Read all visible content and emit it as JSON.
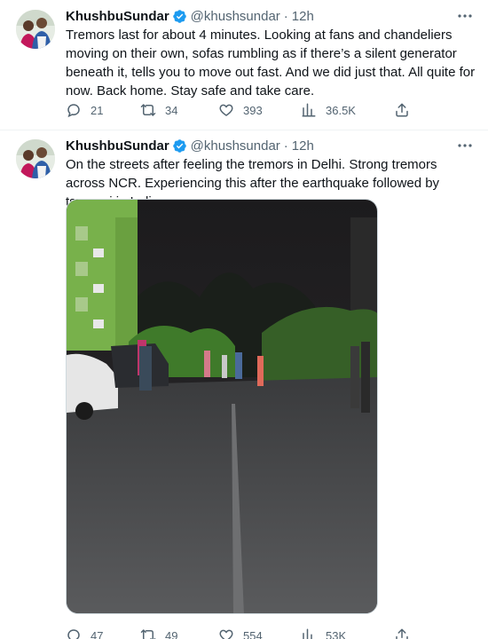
{
  "tweets": [
    {
      "author": {
        "name": "KhushbuSundar",
        "handle": "@khushsundar",
        "verified": true
      },
      "separator": "·",
      "time": "12h",
      "text": "Tremors last for about 4 minutes. Looking at fans and chandeliers moving on their own, sofas rumbling as if there’s a silent generator beneath it, tells you to move out fast. And we did just that. All quite for now. Back home. Stay safe and take care.",
      "stats": {
        "replies": "21",
        "retweets": "34",
        "likes": "393",
        "views": "36.5K"
      }
    },
    {
      "author": {
        "name": "KhushbuSundar",
        "handle": "@khushsundar",
        "verified": true
      },
      "separator": "·",
      "time": "12h",
      "text": "On the streets after feeling the tremors in Delhi. Strong tremors across NCR. Experiencing this after the earthquake followed by tsunami in India.",
      "stats": {
        "replies": "47",
        "retweets": "49",
        "likes": "554",
        "views": "53K"
      }
    }
  ],
  "colors": {
    "verified_badge": "#1d9bf0",
    "text_primary": "#0f1419",
    "text_secondary": "#536471",
    "divider": "#eff3f4"
  },
  "icons": [
    "verified-badge-icon",
    "more-options-icon",
    "reply-icon",
    "retweet-icon",
    "like-icon",
    "views-icon",
    "share-icon"
  ]
}
